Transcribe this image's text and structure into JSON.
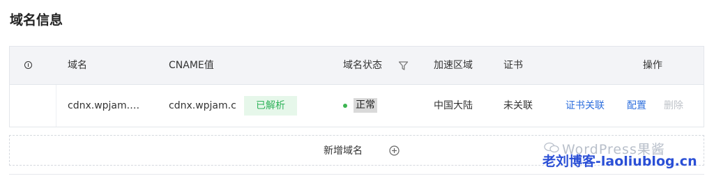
{
  "section": {
    "title": "域名信息"
  },
  "table": {
    "headers": {
      "domain": "域名",
      "cname": "CNAME值",
      "status": "域名状态",
      "region": "加速区域",
      "cert": "证书",
      "actions": "操作"
    },
    "row": {
      "domain": "cdnx.wpjam.…",
      "cname": "cdnx.wpjam.c",
      "cname_badge": "已解析",
      "status": "正常",
      "region": "中国大陆",
      "cert": "未关联",
      "action_cert": "证书关联",
      "action_config": "配置",
      "action_delete": "删除"
    }
  },
  "add_domain": {
    "label": "新增域名"
  },
  "watermark": {
    "line1": "WordPress果酱",
    "line2": "老刘博客-laoliublog.cn"
  },
  "colors": {
    "link": "#2e6fdd",
    "status_dot": "#3cb551",
    "badge_text": "#2fb35a",
    "badge_bg": "#e6f7ea",
    "disabled": "#bfc3c9"
  }
}
